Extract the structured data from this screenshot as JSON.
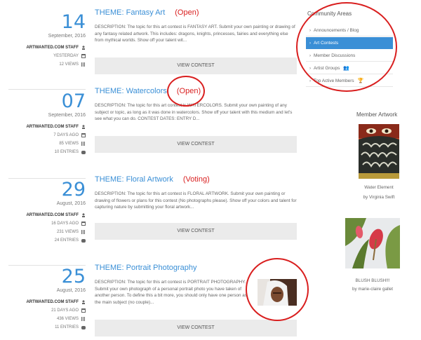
{
  "contests": [
    {
      "day": "14",
      "month_year": "September, 2016",
      "author": "ARTWANTED.COM STAFF",
      "posted": "YESTERDAY",
      "views": "12 VIEWS",
      "entries": "",
      "title": "THEME: Fantasy Art",
      "status": "(Open)",
      "description": "DESCRIPTION: The topic for this art contest is FANTASY ART. Submit your own painting or drawing of any fantasy related artwork. This includes: dragons, knights, princesses, fairies and everything else from mythical worlds. Show off your talent wit...",
      "button": "VIEW CONTEST"
    },
    {
      "day": "07",
      "month_year": "September, 2016",
      "author": "ARTWANTED.COM STAFF",
      "posted": "7 DAYS AGO",
      "views": "85 VIEWS",
      "entries": "10 ENTRIES",
      "title": "THEME: Watercolors",
      "status": "(Open)",
      "description": "DESCRIPTION: The topic for this art contest is WATERCOLORS. Submit your own painting of any subject or topic, as long as it was done in watercolors. Show off your talent with this medium and let's see what you can do. CONTEST DATES: ENTRY D...",
      "button": "VIEW CONTEST"
    },
    {
      "day": "29",
      "month_year": "August, 2016",
      "author": "ARTWANTED.COM STAFF",
      "posted": "16 DAYS AGO",
      "views": "231 VIEWS",
      "entries": "24 ENTRIES",
      "title": "THEME: Floral Artwork",
      "status": "(Voting)",
      "description": "DESCRIPTION: The topic for this art contest is FLORAL ARTWORK. Submit your own painting or drawing of flowers or plans for this contest (No photographs please). Show off your colors and talent for capturing nature by submitting your floral artwork...",
      "button": "VIEW CONTEST"
    },
    {
      "day": "25",
      "month_year": "August, 2016",
      "author": "ARTWANTED.COM STAFF",
      "posted": "21 DAYS AGO",
      "views": "436 VIEWS",
      "entries": "11 ENTRIES",
      "title": "THEME: Portrait Photography",
      "status": "",
      "description": "DESCRIPTION: The topic for this art contest is PORTRAIT PHOTOGRAPHY. Submit your own photograph of a personal portrait photo you have taken of another person. To define this a bit more, you should only have one person as the main subject (no couple)...",
      "button": "VIEW CONTEST"
    }
  ],
  "sidebar": {
    "title": "Community Areas",
    "items": [
      {
        "label": "Announcements / Blog",
        "icon": ""
      },
      {
        "label": "Art Contests",
        "icon": ""
      },
      {
        "label": "Member Discussions",
        "icon": ""
      },
      {
        "label": "Artist Groups",
        "icon": "users-icon"
      },
      {
        "label": "Top Active Members",
        "icon": "trophy-icon"
      }
    ]
  },
  "member_artwork": {
    "title": "Member Artwork",
    "items": [
      {
        "caption": "Water Element",
        "by": "by Virginia Swift"
      },
      {
        "caption": "BLUSH BLUSH!!!",
        "by": "by marie-claire gallet"
      }
    ]
  },
  "colors": {
    "accent": "#3a8fd6",
    "highlight": "#d91f1f"
  }
}
